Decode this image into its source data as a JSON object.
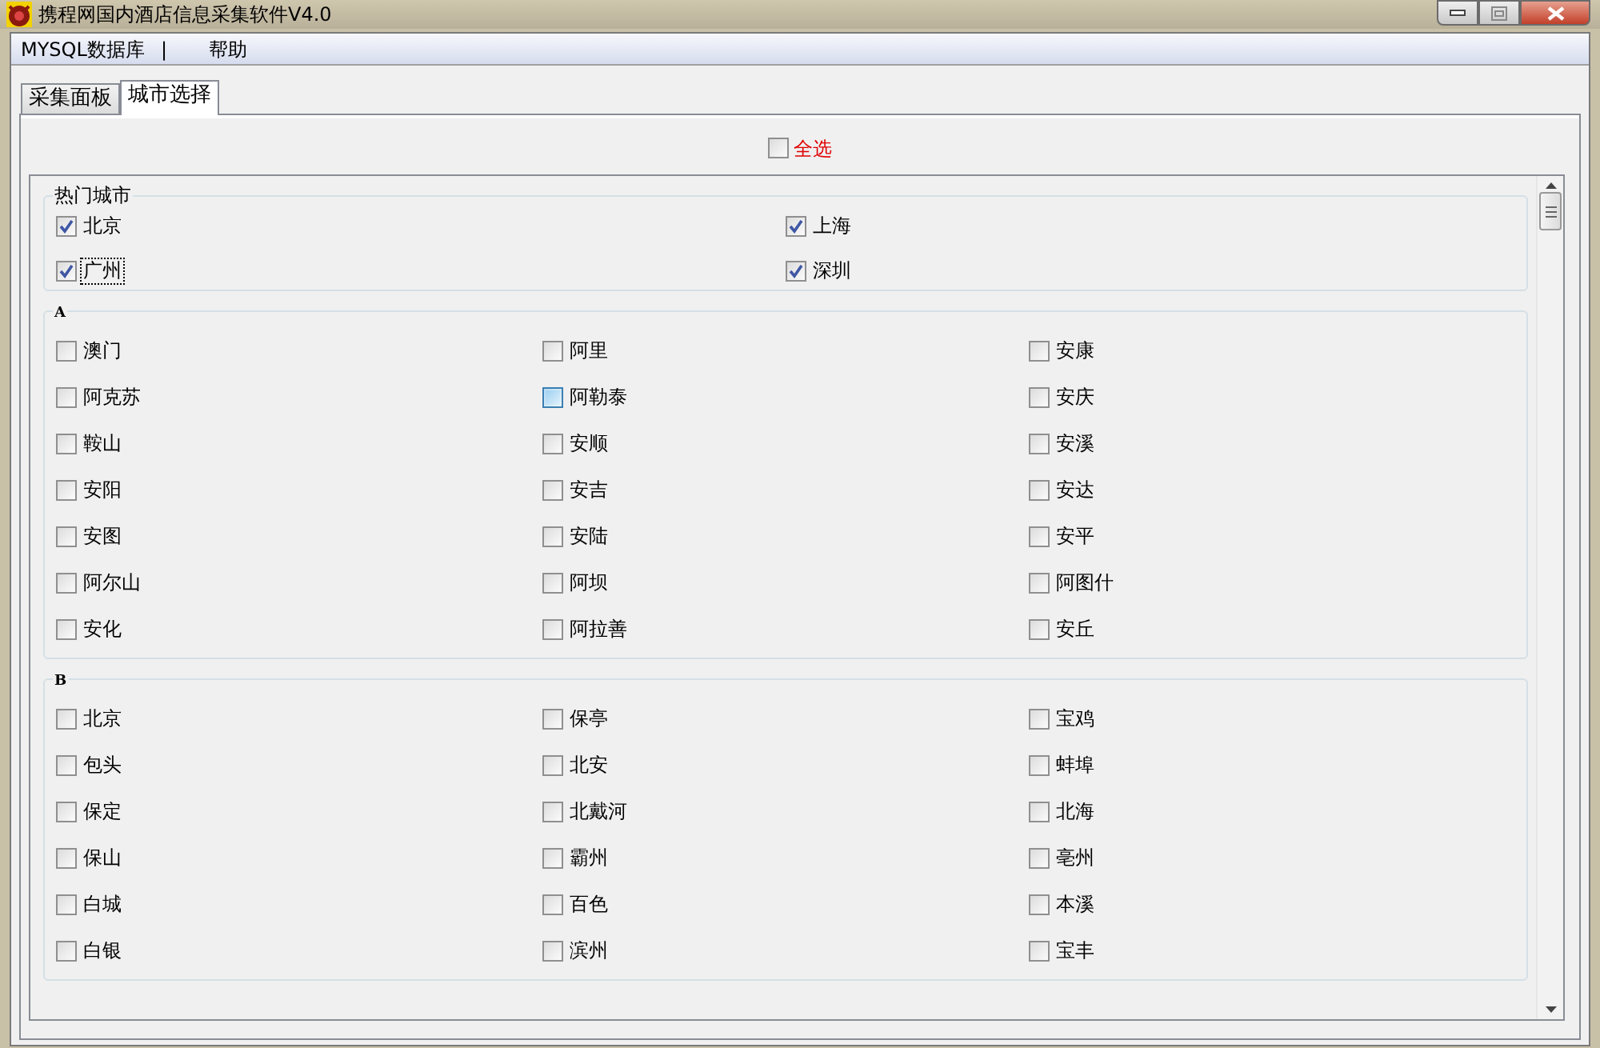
{
  "window": {
    "title": "携程网国内酒店信息采集软件V4.0"
  },
  "menu": [
    {
      "kind": "item",
      "label": "MYSQL数据库"
    },
    {
      "kind": "separator",
      "label": "|"
    },
    {
      "kind": "item",
      "label": "帮助"
    }
  ],
  "tabs": [
    {
      "label": "采集面板",
      "selected": false
    },
    {
      "label": "城市选择",
      "selected": true
    }
  ],
  "select_all": {
    "label": "全选",
    "checked": false
  },
  "groups": [
    {
      "kind": "hot",
      "title": "热门城市",
      "cities": [
        {
          "name": "北京",
          "checked": true,
          "focused": false,
          "hovered": false
        },
        {
          "name": "上海",
          "checked": true,
          "focused": false,
          "hovered": false
        },
        {
          "name": "广州",
          "checked": true,
          "focused": true,
          "hovered": false
        },
        {
          "name": "深圳",
          "checked": true,
          "focused": false,
          "hovered": false
        }
      ]
    },
    {
      "kind": "letter",
      "title": "A",
      "cities": [
        {
          "name": "澳门",
          "checked": false,
          "focused": false,
          "hovered": false
        },
        {
          "name": "阿里",
          "checked": false,
          "focused": false,
          "hovered": false
        },
        {
          "name": "安康",
          "checked": false,
          "focused": false,
          "hovered": false
        },
        {
          "name": "阿克苏",
          "checked": false,
          "focused": false,
          "hovered": false
        },
        {
          "name": "阿勒泰",
          "checked": false,
          "focused": false,
          "hovered": true
        },
        {
          "name": "安庆",
          "checked": false,
          "focused": false,
          "hovered": false
        },
        {
          "name": "鞍山",
          "checked": false,
          "focused": false,
          "hovered": false
        },
        {
          "name": "安顺",
          "checked": false,
          "focused": false,
          "hovered": false
        },
        {
          "name": "安溪",
          "checked": false,
          "focused": false,
          "hovered": false
        },
        {
          "name": "安阳",
          "checked": false,
          "focused": false,
          "hovered": false
        },
        {
          "name": "安吉",
          "checked": false,
          "focused": false,
          "hovered": false
        },
        {
          "name": "安达",
          "checked": false,
          "focused": false,
          "hovered": false
        },
        {
          "name": "安图",
          "checked": false,
          "focused": false,
          "hovered": false
        },
        {
          "name": "安陆",
          "checked": false,
          "focused": false,
          "hovered": false
        },
        {
          "name": "安平",
          "checked": false,
          "focused": false,
          "hovered": false
        },
        {
          "name": "阿尔山",
          "checked": false,
          "focused": false,
          "hovered": false
        },
        {
          "name": "阿坝",
          "checked": false,
          "focused": false,
          "hovered": false
        },
        {
          "name": "阿图什",
          "checked": false,
          "focused": false,
          "hovered": false
        },
        {
          "name": "安化",
          "checked": false,
          "focused": false,
          "hovered": false
        },
        {
          "name": "阿拉善",
          "checked": false,
          "focused": false,
          "hovered": false
        },
        {
          "name": "安丘",
          "checked": false,
          "focused": false,
          "hovered": false
        }
      ]
    },
    {
      "kind": "letter",
      "title": "B",
      "cities": [
        {
          "name": "北京",
          "checked": false,
          "focused": false,
          "hovered": false
        },
        {
          "name": "保亭",
          "checked": false,
          "focused": false,
          "hovered": false
        },
        {
          "name": "宝鸡",
          "checked": false,
          "focused": false,
          "hovered": false
        },
        {
          "name": "包头",
          "checked": false,
          "focused": false,
          "hovered": false
        },
        {
          "name": "北安",
          "checked": false,
          "focused": false,
          "hovered": false
        },
        {
          "name": "蚌埠",
          "checked": false,
          "focused": false,
          "hovered": false
        },
        {
          "name": "保定",
          "checked": false,
          "focused": false,
          "hovered": false
        },
        {
          "name": "北戴河",
          "checked": false,
          "focused": false,
          "hovered": false
        },
        {
          "name": "北海",
          "checked": false,
          "focused": false,
          "hovered": false
        },
        {
          "name": "保山",
          "checked": false,
          "focused": false,
          "hovered": false
        },
        {
          "name": "霸州",
          "checked": false,
          "focused": false,
          "hovered": false
        },
        {
          "name": "亳州",
          "checked": false,
          "focused": false,
          "hovered": false
        },
        {
          "name": "白城",
          "checked": false,
          "focused": false,
          "hovered": false
        },
        {
          "name": "百色",
          "checked": false,
          "focused": false,
          "hovered": false
        },
        {
          "name": "本溪",
          "checked": false,
          "focused": false,
          "hovered": false
        },
        {
          "name": "白银",
          "checked": false,
          "focused": false,
          "hovered": false
        },
        {
          "name": "滨州",
          "checked": false,
          "focused": false,
          "hovered": false
        },
        {
          "name": "宝丰",
          "checked": false,
          "focused": false,
          "hovered": false
        }
      ]
    }
  ]
}
